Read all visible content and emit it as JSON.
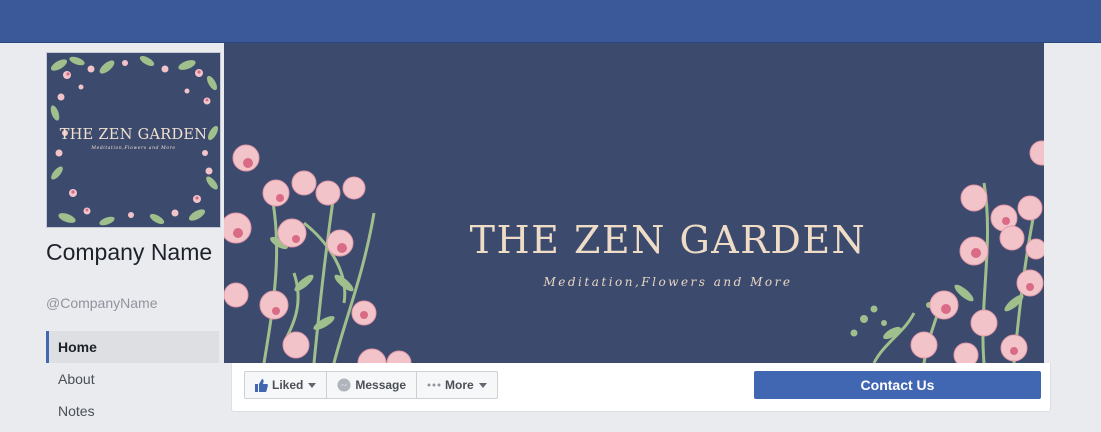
{
  "page": {
    "company_name": "Company Name",
    "handle": "@CompanyName"
  },
  "profile_picture": {
    "title": "THE ZEN GARDEN",
    "subtitle": "Meditation,Flowers and More"
  },
  "cover": {
    "title": "THE ZEN GARDEN",
    "subtitle": "Meditation,Flowers and More"
  },
  "side_nav": {
    "items": [
      {
        "label": "Home",
        "active": true
      },
      {
        "label": "About",
        "active": false
      },
      {
        "label": "Notes",
        "active": false
      }
    ]
  },
  "actions": {
    "liked_label": "Liked",
    "message_label": "Message",
    "more_label": "More",
    "contact_label": "Contact Us"
  },
  "colors": {
    "topbar": "#3b5998",
    "cover_background": "#3c4a6e",
    "flower_pink": "#f2c4c9",
    "accent_blue": "#4267b2",
    "leaf_green": "#9fc08d"
  }
}
